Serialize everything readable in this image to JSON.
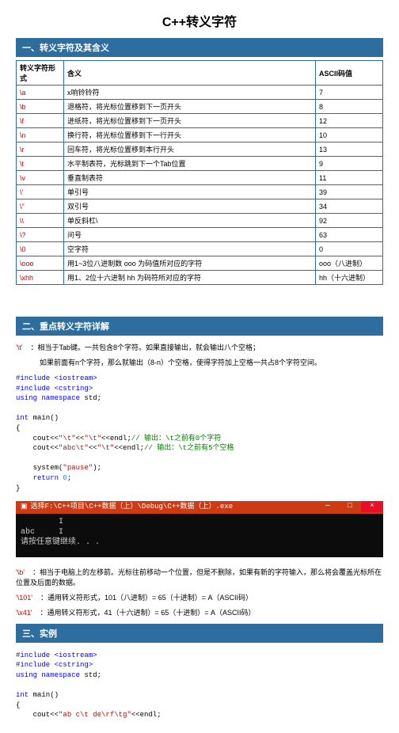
{
  "title": "C++转义字符",
  "section1": {
    "header": "一、转义字符及其含义",
    "columns": [
      "转义字符形式",
      "含义",
      "ASCII码值"
    ],
    "rows": [
      [
        "\\a",
        "x响铃铃符",
        "7"
      ],
      [
        "\\b",
        "退格符，将光标位置移到下一页开头",
        "8"
      ],
      [
        "\\f",
        "进纸符，将光标位置移到下一页开头",
        "12"
      ],
      [
        "\\n",
        "换行符，将光标位置移到下一行开头",
        "10"
      ],
      [
        "\\r",
        "回车符，将光标位置移到本行开头",
        "13"
      ],
      [
        "\\t",
        "水平制表符，光标跳到下一个Tab位置",
        "9"
      ],
      [
        "\\v",
        "垂直制表符",
        "11"
      ],
      [
        "\\'",
        "单引号",
        "39"
      ],
      [
        "\\\"",
        "双引号",
        "34"
      ],
      [
        "\\\\",
        "单反斜杠\\",
        "92"
      ],
      [
        "\\?",
        "问号",
        "63"
      ],
      [
        "\\0",
        "空字符",
        "0"
      ],
      [
        "\\ooo",
        "用1~3位八进制数 ooo 为码值所对应的字符",
        "ooo（八进制）"
      ],
      [
        "\\xhh",
        "用1、2位十六进制 hh 为码符所对应的字符",
        "hh（十六进制）"
      ]
    ]
  },
  "section2": {
    "header": "二、重点转义字符详解",
    "lines": {
      "t1_esc": "'\\t'",
      "t1": "：相当于Tab键。一共包含8个字符。如果直接输出，就会输出八个空格；",
      "t2": "如果前面有n个字符，那么就输出（8-n）个空格，使得字符加上空格一共占8个字符空间。",
      "b_esc": "'\\b'",
      "b": "：相当于电脑上的左移箭。光标往前移动一个位置，但是不删除，如果有新的字符输入，那么将会覆盖光标所在位置及后面的数据。",
      "o_esc": "'\\101'",
      "o": "：通用转义符形式，101（八进制）= 65（十进制）= A（ASCII码）",
      "x_esc": "'\\x41'",
      "x": "：通用转义符形式，41（十六进制）= 65（十进制）= A（ASCII码）"
    },
    "code1": {
      "l1": "#include <iostream>",
      "l2": "#include <cstring>",
      "l3a": "using namespace",
      "l3b": " std;",
      "l5a": "int",
      "l5b": " main()",
      "l6": "{",
      "l7a": "    cout<<",
      "l7b": "\"\\t\"",
      "l7c": "<<",
      "l7d": "\"\\t\"",
      "l7e": "<<endl;",
      "l7f": "// 输出：\\t之前有0个字符",
      "l8a": "    cout<<",
      "l8b": "\"abc\\t\"",
      "l8c": "<<",
      "l8d": "\"\\t\"",
      "l8e": "<<endl;",
      "l8f": "// 输出：\\t之前有5个空格",
      "l10a": "    system(",
      "l10b": "\"pause\"",
      "l10c": ");",
      "l11a": "    return",
      "l11b": " 0",
      "l11c": ";",
      "l12": "}"
    },
    "console": {
      "title": "选择F:\\C++项目\\C++数据（上）\\Debug\\C++数据（上）.exe",
      "body": "        I\nabc     I\n请按任意键继续. . ."
    }
  },
  "section3": {
    "header": "三、实例",
    "code": {
      "l1": "#include <iostream>",
      "l2": "#include <cstring>",
      "l3a": "using namespace",
      "l3b": " std;",
      "l5a": "int",
      "l5b": " main()",
      "l6": "{",
      "l7a": "    cout<<",
      "l7b": "\"",
      "l7c": "ab c\\t de\\rf\\tg",
      "l7d": "\"",
      "l7e": "<<endl;"
    }
  }
}
